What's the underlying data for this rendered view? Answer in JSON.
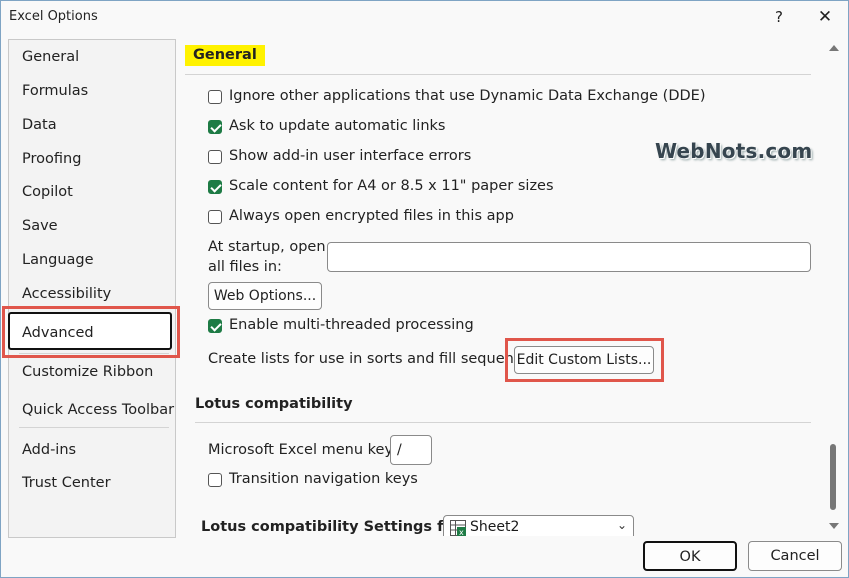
{
  "window": {
    "title": "Excel Options",
    "help_label": "?",
    "close_label": "✕"
  },
  "sidebar": {
    "items": [
      {
        "label": "General"
      },
      {
        "label": "Formulas"
      },
      {
        "label": "Data"
      },
      {
        "label": "Proofing"
      },
      {
        "label": "Copilot"
      },
      {
        "label": "Save"
      },
      {
        "label": "Language"
      },
      {
        "label": "Accessibility"
      },
      {
        "label": "Advanced",
        "selected": true
      },
      {
        "label": "Customize Ribbon"
      },
      {
        "label": "Quick Access Toolbar"
      },
      {
        "label": "Add-ins"
      },
      {
        "label": "Trust Center"
      }
    ]
  },
  "content": {
    "general_heading": "General",
    "options": [
      {
        "label": "Ignore other applications that use Dynamic Data Exchange (DDE)",
        "checked": false
      },
      {
        "label": "Ask to update automatic links",
        "checked": true
      },
      {
        "label": "Show add-in user interface errors",
        "checked": false
      },
      {
        "label": "Scale content for A4 or 8.5 x 11\" paper sizes",
        "checked": true
      },
      {
        "label": "Always open encrypted files in this app",
        "checked": false
      }
    ],
    "startup_label_line1": "At startup, open",
    "startup_label_line2": "all files in:",
    "startup_value": "",
    "web_options_label": "Web Options...",
    "multithread": {
      "label": "Enable multi-threaded processing",
      "checked": true
    },
    "custom_lists_label": "Create lists for use in sorts and fill sequences:",
    "edit_custom_lists_label": "Edit Custom Lists...",
    "lotus_heading": "Lotus compatibility",
    "menu_key_label": "Microsoft Excel menu key:",
    "menu_key_value": "/",
    "transition_nav": {
      "label": "Transition navigation keys",
      "checked": false
    },
    "lotus_settings_label": "Lotus compatibility Settings for:",
    "lotus_sheet_value": "Sheet2"
  },
  "watermark": "WebNots.com",
  "footer": {
    "ok_label": "OK",
    "cancel_label": "Cancel"
  },
  "colors": {
    "accent_green": "#1e7b45",
    "highlight_yellow": "#fff200",
    "annotation_red": "#e0564b"
  }
}
